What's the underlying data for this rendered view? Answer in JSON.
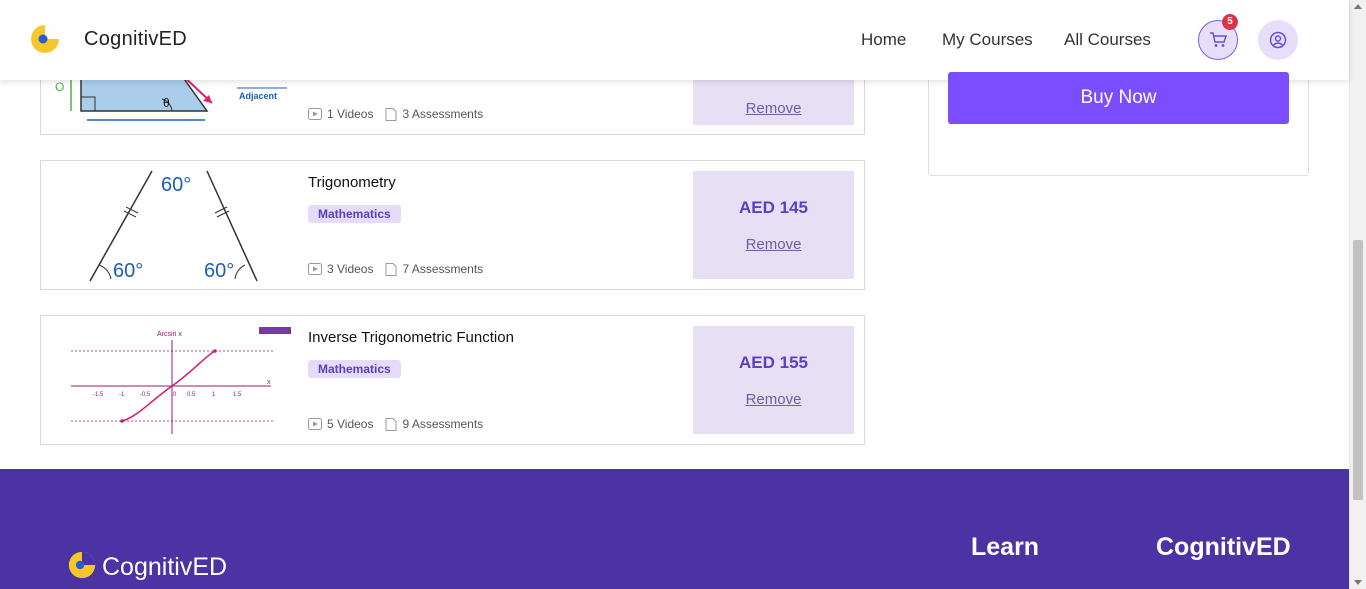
{
  "header": {
    "brand": "CognitivED",
    "nav": [
      "Home",
      "My Courses",
      "All Courses"
    ],
    "cart_count": "5"
  },
  "summary": {
    "buy_label": "Buy Now"
  },
  "cards": [
    {
      "title": "",
      "tag": "",
      "videos": "1 Videos",
      "assessments": "3 Assessments",
      "price": "",
      "remove": "Remove",
      "thumb_labels": {
        "adjacent": "Adjacent",
        "theta": "θ",
        "opp": "O"
      }
    },
    {
      "title": "Trigonometry",
      "tag": "Mathematics",
      "videos": "3 Videos",
      "assessments": "7 Assessments",
      "price": "AED 145",
      "remove": "Remove",
      "thumb_labels": {
        "top": "60°",
        "left": "60°",
        "right": "60°"
      }
    },
    {
      "title": "Inverse Trigonometric Function",
      "tag": "Mathematics",
      "videos": "5 Videos",
      "assessments": "9 Assessments",
      "price": "AED 155",
      "remove": "Remove",
      "thumb_labels": {
        "title": "Arcsin x",
        "xaxis": "x",
        "ticks": [
          "-1.5",
          "-1",
          "-0.5",
          "0",
          "0.5",
          "1",
          "1.5"
        ]
      }
    }
  ],
  "footer": {
    "brand": "CognitivED",
    "headings": [
      "Learn",
      "CognitivED"
    ]
  },
  "colors": {
    "accent": "#7a4dff",
    "footer": "#4b33a3",
    "tag_bg": "#e4dcf8",
    "price_bg": "#e7e0f4"
  }
}
